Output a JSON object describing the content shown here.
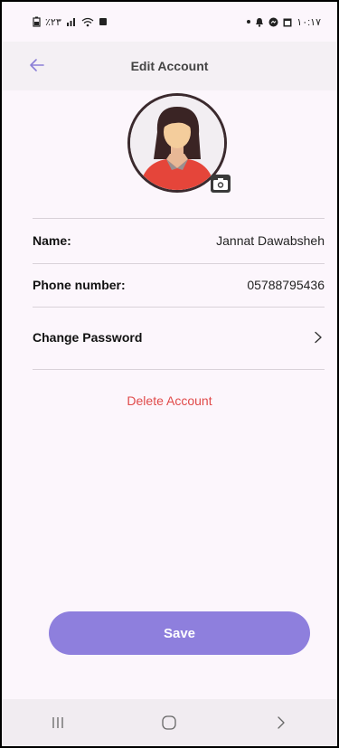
{
  "status_bar": {
    "left_text": "٪٢٣",
    "time": "١٠:١٧"
  },
  "header": {
    "title": "Edit Account"
  },
  "profile": {
    "name_label": "Name:",
    "name_value": "Jannat Dawabsheh",
    "phone_label": "Phone number:",
    "phone_value": "05788795436",
    "change_password_label": "Change Password"
  },
  "actions": {
    "delete_label": "Delete Account",
    "save_label": "Save"
  },
  "colors": {
    "accent": "#8e7fdd",
    "danger": "#e04a4a",
    "background": "#fcf6fc",
    "appbar": "#f4f0f4"
  },
  "icons": {
    "back": "arrow-left-icon",
    "camera": "camera-icon",
    "chevron": "chevron-right-icon"
  }
}
